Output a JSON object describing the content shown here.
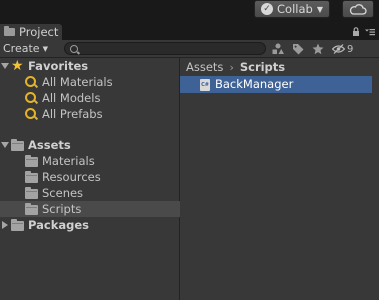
{
  "toolbar": {
    "collab_label": "Collab",
    "cloud_icon": "cloud-icon"
  },
  "tab": {
    "title": "Project",
    "lock_icon": "lock-icon",
    "menu_icon": "menu-icon"
  },
  "tools": {
    "create_label": "Create",
    "search_placeholder": "",
    "hidden_count": "9"
  },
  "tree": {
    "favorites_label": "Favorites",
    "favorites": [
      {
        "label": "All Materials"
      },
      {
        "label": "All Models"
      },
      {
        "label": "All Prefabs"
      }
    ],
    "assets_label": "Assets",
    "assets_children": [
      {
        "label": "Materials"
      },
      {
        "label": "Resources"
      },
      {
        "label": "Scenes"
      },
      {
        "label": "Scripts",
        "selected": true
      }
    ],
    "packages_label": "Packages"
  },
  "breadcrumb": {
    "root": "Assets",
    "current": "Scripts"
  },
  "files": [
    {
      "name": "BackManager",
      "type": "cs-script",
      "selected": true
    }
  ],
  "colors": {
    "selection": "#3e6296",
    "panel_bg": "#383838",
    "favorite_icon": "#e2b32c"
  }
}
